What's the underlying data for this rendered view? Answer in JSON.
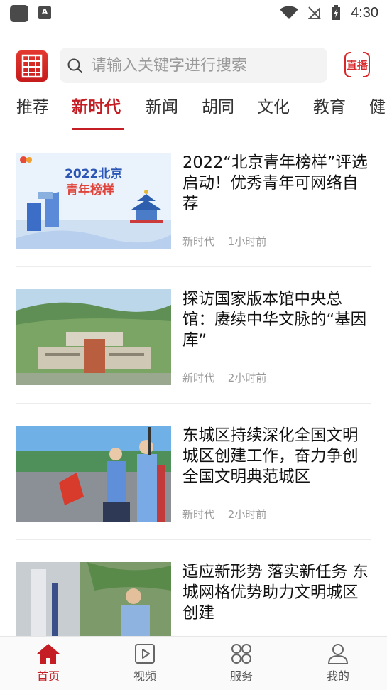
{
  "status_bar": {
    "time": "4:30",
    "a_icon_letter": "A"
  },
  "header": {
    "search_placeholder": "请输入关键字进行搜索",
    "live_label": "直播"
  },
  "tabs": [
    {
      "label": "推荐"
    },
    {
      "label": "新时代"
    },
    {
      "label": "新闻"
    },
    {
      "label": "胡同"
    },
    {
      "label": "文化"
    },
    {
      "label": "教育"
    },
    {
      "label": "健"
    }
  ],
  "active_tab": "新时代",
  "articles": [
    {
      "title": "2022“北京青年榜样”评选启动！优秀青年可网络自荐",
      "category": "新时代",
      "time": "1小时前",
      "thumb_text_1": "2022北京",
      "thumb_text_2": "青年榜样"
    },
    {
      "title": "探访国家版本馆中央总馆：赓续中华文脉的“基因库”",
      "category": "新时代",
      "time": "2小时前"
    },
    {
      "title": "东城区持续深化全国文明城区创建工作，奋力争创全国文明典范城区",
      "category": "新时代",
      "time": "2小时前"
    },
    {
      "title": "适应新形势 落实新任务 东城网格优势助力文明城区创建",
      "category": "",
      "time": ""
    }
  ],
  "bottom_nav": [
    {
      "label": "首页",
      "icon": "home-icon",
      "active": true
    },
    {
      "label": "视频",
      "icon": "video-icon",
      "active": false
    },
    {
      "label": "服务",
      "icon": "services-icon",
      "active": false
    },
    {
      "label": "我的",
      "icon": "profile-icon",
      "active": false
    }
  ],
  "colors": {
    "accent": "#c41e24",
    "text": "#111111",
    "meta": "#999999"
  }
}
